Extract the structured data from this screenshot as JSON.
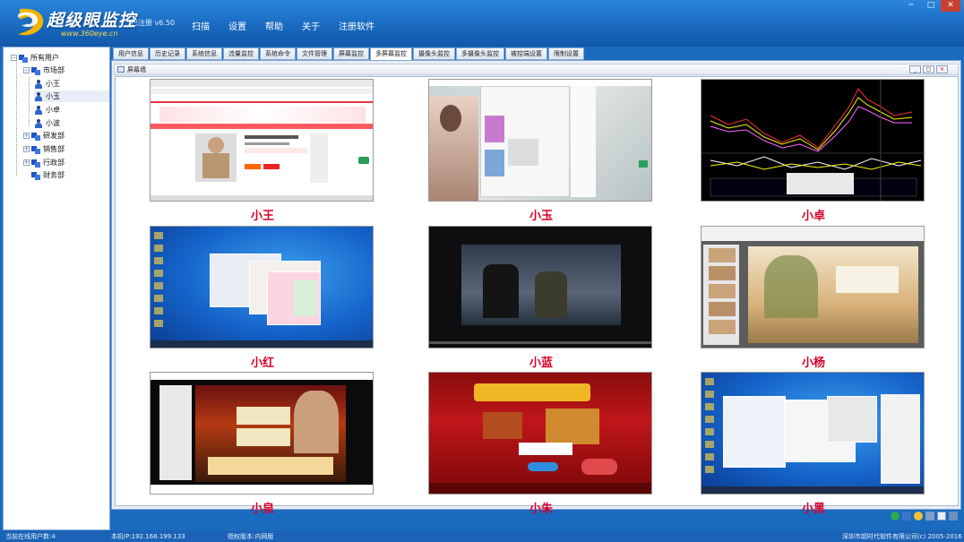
{
  "app": {
    "brand": "超级眼监控",
    "url": "www.360eye.cn",
    "registration": "已注册 v6.50"
  },
  "menu": [
    "扫描",
    "设置",
    "帮助",
    "关于",
    "注册软件"
  ],
  "window_buttons": [
    "─",
    "□",
    "✕"
  ],
  "tree": {
    "root": "所有用户",
    "groups": [
      {
        "label": "市场部",
        "users": [
          "小王",
          "小玉",
          "小卓",
          "小波"
        ]
      },
      {
        "label": "研发部"
      },
      {
        "label": "销售部"
      },
      {
        "label": "行政部"
      },
      {
        "label": "财务部"
      }
    ],
    "selected": "小玉"
  },
  "tabs": [
    "用户信息",
    "历史记录",
    "系统信息",
    "流量监控",
    "系统命令",
    "文件管理",
    "屏幕监控",
    "多屏幕监控",
    "摄像头监控",
    "多摄像头监控",
    "被控端设置",
    "限制设置"
  ],
  "active_tab": "多屏幕监控",
  "panel": {
    "title": "屏幕墙"
  },
  "screens": [
    {
      "name": "小王",
      "icon": "shopping-page-thumbnail"
    },
    {
      "name": "小玉",
      "icon": "photo-chat-thumbnail"
    },
    {
      "name": "小卓",
      "icon": "stock-chart-thumbnail"
    },
    {
      "name": "小红",
      "icon": "windows-desktop-thumbnail"
    },
    {
      "name": "小蓝",
      "icon": "movie-thumbnail"
    },
    {
      "name": "小杨",
      "icon": "presentation-thumbnail"
    },
    {
      "name": "小泉",
      "icon": "game-thumbnail"
    },
    {
      "name": "小朱",
      "icon": "card-game-thumbnail"
    },
    {
      "name": "小黑",
      "icon": "windows-desktop-thumbnail"
    }
  ],
  "status": {
    "online": "当前在线用户数:4",
    "ip": "本机IP:192.168.199.133",
    "license": "授权版本:内网版",
    "copyright": "深圳市超时代软件有限公司(c) 2005-2016"
  },
  "colors": {
    "accent": "#1a6bc0",
    "caption": "#d8002a"
  }
}
